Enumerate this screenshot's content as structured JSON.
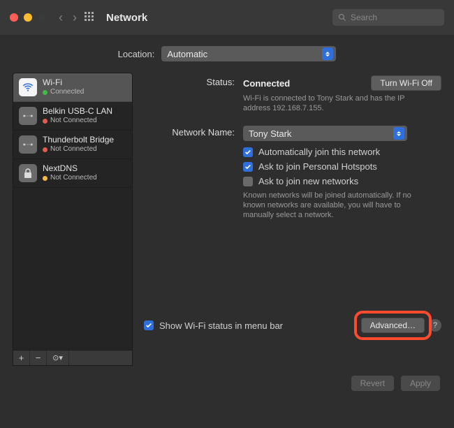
{
  "window": {
    "title": "Network"
  },
  "search": {
    "placeholder": "Search"
  },
  "location": {
    "label": "Location:",
    "value": "Automatic"
  },
  "services": [
    {
      "name": "Wi-Fi",
      "status": "Connected",
      "status_color": "g",
      "icon": "wifi",
      "selected": true
    },
    {
      "name": "Belkin USB-C LAN",
      "status": "Not Connected",
      "status_color": "r",
      "icon": "lan",
      "selected": false
    },
    {
      "name": "Thunderbolt Bridge",
      "status": "Not Connected",
      "status_color": "r",
      "icon": "lan",
      "selected": false
    },
    {
      "name": "NextDNS",
      "status": "Not Connected",
      "status_color": "y",
      "icon": "lock",
      "selected": false
    }
  ],
  "sidebar_controls": {
    "add": "+",
    "remove": "−",
    "more": "⊙▾"
  },
  "status": {
    "label": "Status:",
    "value": "Connected",
    "toggle": "Turn Wi-Fi Off",
    "detail": "Wi-Fi is connected to Tony Stark and has the IP address 192.168.7.155."
  },
  "network_name": {
    "label": "Network Name:",
    "value": "Tony Stark"
  },
  "options": {
    "auto_join": {
      "label": "Automatically join this network",
      "checked": true
    },
    "hotspots": {
      "label": "Ask to join Personal Hotspots",
      "checked": true
    },
    "new_networks": {
      "label": "Ask to join new networks",
      "checked": false
    },
    "hint": "Known networks will be joined automatically. If no known networks are available, you will have to manually select a network."
  },
  "footer": {
    "menubar": {
      "label": "Show Wi-Fi status in menu bar",
      "checked": true
    },
    "advanced": "Advanced…",
    "help": "?"
  },
  "buttons": {
    "revert": "Revert",
    "apply": "Apply"
  }
}
